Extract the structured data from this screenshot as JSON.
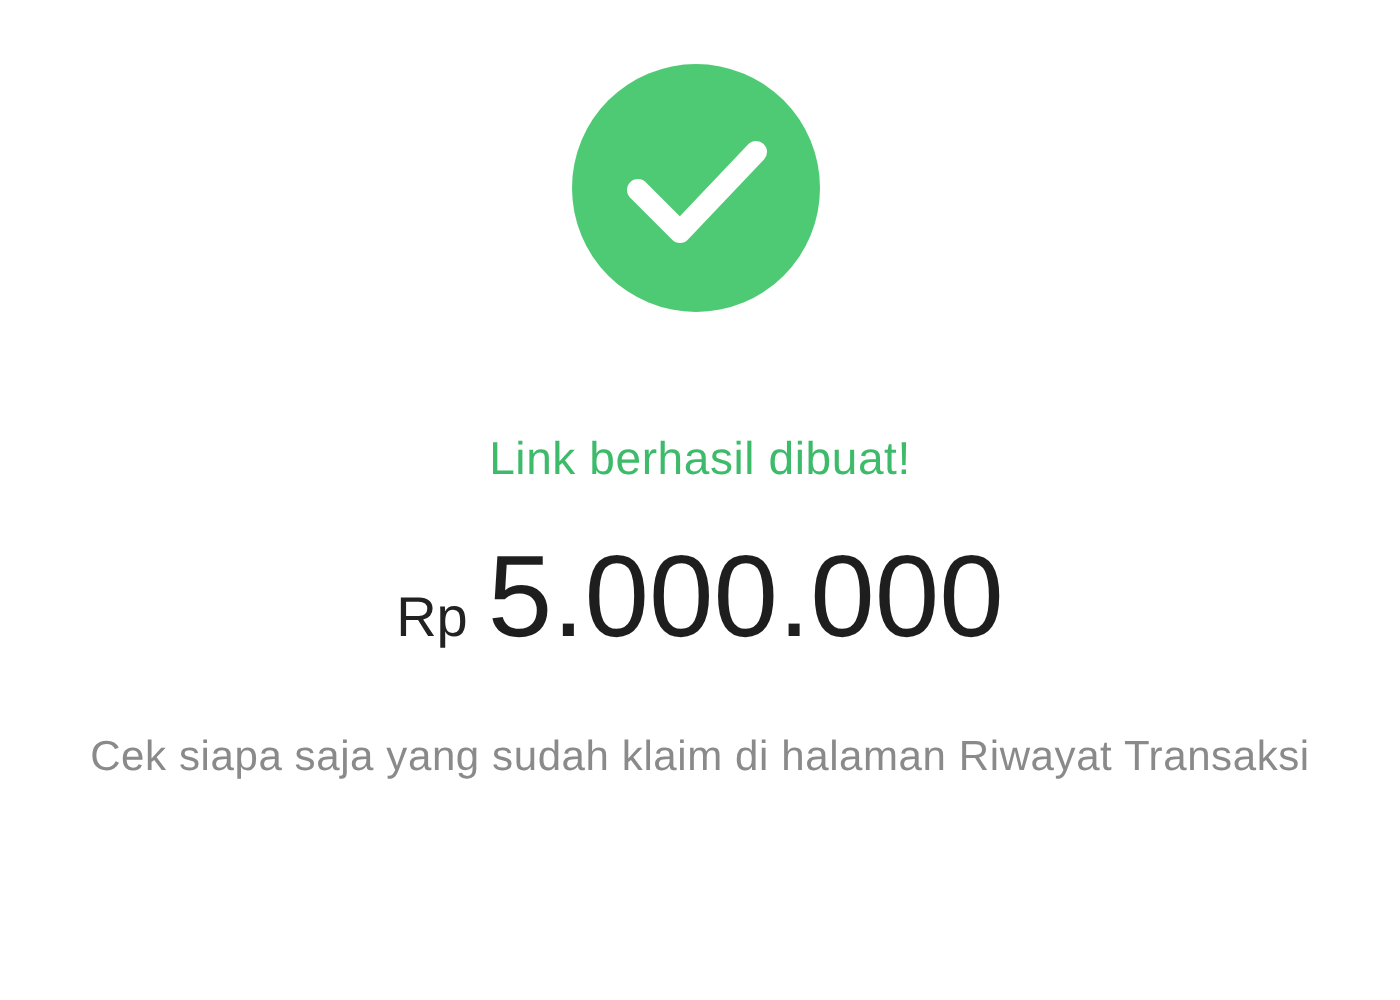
{
  "status": {
    "title": "Link berhasil dibuat!",
    "currency": "Rp",
    "amount": "5.000.000",
    "description": "Cek siapa saja yang sudah klaim di halaman Riwayat Transaksi"
  }
}
